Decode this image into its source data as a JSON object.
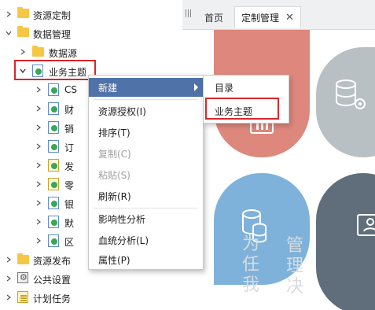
{
  "tree": {
    "items": [
      {
        "label": "资源定制",
        "icon": "folder-icon",
        "expanded": false
      },
      {
        "label": "数据管理",
        "icon": "folder-icon",
        "expanded": true
      },
      {
        "label": "数据源",
        "icon": "folder-icon",
        "expanded": false
      },
      {
        "label": "业务主题",
        "icon": "theme-icon",
        "expanded": true,
        "selected": true
      },
      {
        "label": "CS"
      },
      {
        "label": "财"
      },
      {
        "label": "销"
      },
      {
        "label": "订"
      },
      {
        "label": "发"
      },
      {
        "label": "零"
      },
      {
        "label": "银"
      },
      {
        "label": "默"
      },
      {
        "label": "区"
      },
      {
        "label": "资源发布",
        "icon": "folder-icon"
      },
      {
        "label": "公共设置",
        "icon": "gear-icon"
      },
      {
        "label": "计划任务",
        "icon": "task-icon"
      }
    ]
  },
  "tabs": {
    "home": "首页",
    "custom": "定制管理",
    "close": "✕"
  },
  "context_menu": {
    "items": [
      {
        "label": "新建",
        "active": true,
        "has_submenu": true
      },
      {
        "label": "资源授权(I)"
      },
      {
        "label": "排序(T)"
      },
      {
        "label": "复制(C)",
        "disabled": true
      },
      {
        "label": "粘贴(S)",
        "disabled": true
      },
      {
        "label": "刷新(R)"
      },
      {
        "label": "影响性分析"
      },
      {
        "label": "血统分析(L)"
      },
      {
        "label": "属性(P)"
      }
    ]
  },
  "submenu": {
    "items": [
      {
        "label": "目录"
      },
      {
        "label": "业务主题",
        "highlighted": true
      }
    ]
  },
  "dashboard": {
    "watermark": [
      "为",
      "任",
      "我",
      "管",
      "理",
      "决"
    ]
  },
  "colors": {
    "menu_active": "#4f73a8",
    "highlight_box": "#d9262a",
    "tile_red": "#dd877d",
    "tile_blue": "#7fb2da",
    "tile_gray_light": "#b8c0c4",
    "tile_gray_dark": "#5f6e7a"
  }
}
